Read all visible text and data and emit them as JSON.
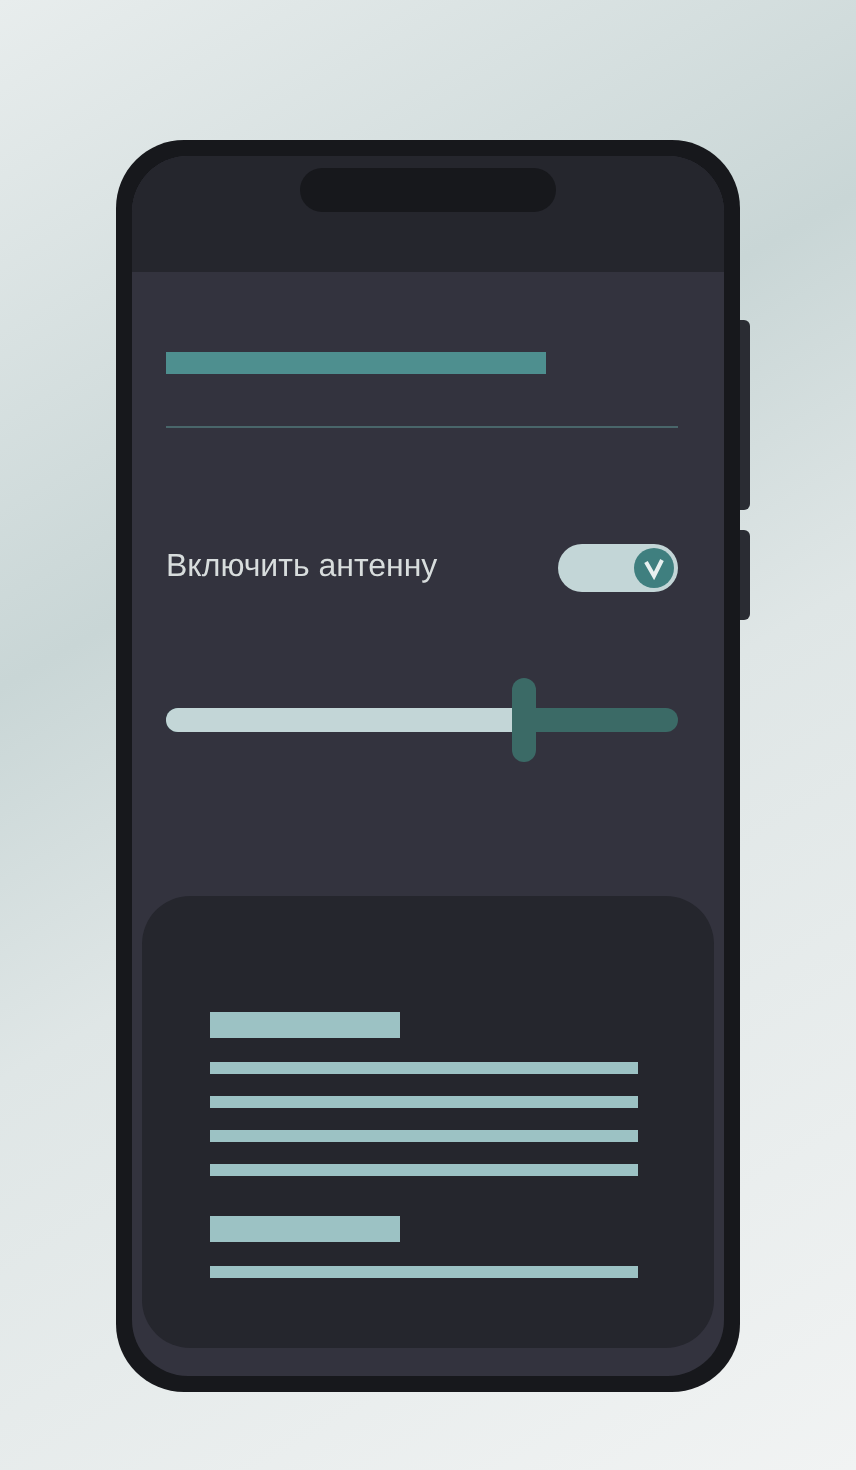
{
  "settings": {
    "toggle": {
      "label": "Включить антенну",
      "on": true
    },
    "slider": {
      "level": 0.7
    }
  }
}
